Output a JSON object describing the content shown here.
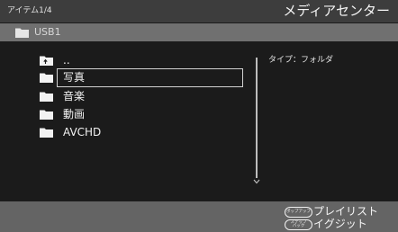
{
  "header": {
    "item_counter": "アイテム1/4",
    "app_title": "メディアセンター"
  },
  "path_bar": {
    "icon": "folder-icon",
    "current_location": "USB1"
  },
  "file_list": {
    "items": [
      {
        "label": "..",
        "icon": "parent-folder-icon",
        "selected": false
      },
      {
        "label": "写真",
        "icon": "folder-icon",
        "selected": true
      },
      {
        "label": "音楽",
        "icon": "folder-icon",
        "selected": false
      },
      {
        "label": "動画",
        "icon": "folder-icon",
        "selected": false
      },
      {
        "label": "AVCHD",
        "icon": "folder-icon",
        "selected": false
      }
    ]
  },
  "details": {
    "type_info": "タイプ：フォルダ"
  },
  "footer": {
    "actions": [
      {
        "button_lines": [
          "ポップアップ"
        ],
        "label": "プレイリスト"
      },
      {
        "button_lines": [
          "ステップ",
          "バック"
        ],
        "label": "イグジット"
      }
    ]
  },
  "colors": {
    "header_bg": "#3d3d3d",
    "path_bar_bg": "#707070",
    "main_bg": "#1b1b1b",
    "footer_bg": "#646464",
    "text": "#f2f2f2",
    "selection_border": "#d2d2d2",
    "scrollbar": "#bdbdbd"
  }
}
